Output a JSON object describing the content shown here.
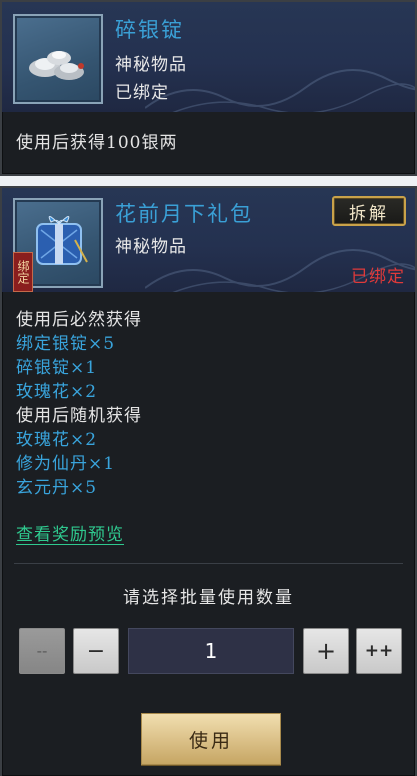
{
  "item1": {
    "name": "碎银锭",
    "type": "神秘物品",
    "bind_status": "已绑定",
    "description": "使用后获得100银两",
    "icon": "silver-ingot-icon"
  },
  "item2": {
    "name": "花前月下礼包",
    "type": "神秘物品",
    "bind_status": "已绑定",
    "bind_tag": "绑定",
    "decompose_label": "拆解",
    "icon": "gift-package-icon",
    "rewards": [
      {
        "text": "使用后必然获得",
        "color": "white"
      },
      {
        "text": "绑定银锭×5",
        "color": "blue"
      },
      {
        "text": "碎银锭×1",
        "color": "blue"
      },
      {
        "text": "玫瑰花×2",
        "color": "blue"
      },
      {
        "text": "使用后随机获得",
        "color": "white"
      },
      {
        "text": "玫瑰花×2",
        "color": "blue"
      },
      {
        "text": "修为仙丹×1",
        "color": "blue"
      },
      {
        "text": "玄元丹×5",
        "color": "blue"
      }
    ],
    "preview_link": "查看奖励预览"
  },
  "batch": {
    "label": "请选择批量使用数量",
    "min_label": "--",
    "minus_label": "−",
    "quantity": "1",
    "plus_label": "+",
    "max_label": "++",
    "use_label": "使用"
  },
  "colors": {
    "title_blue": "#3aa0d6",
    "bound_red": "#e03a3a",
    "link_green": "#2fc98f",
    "gold_border": "#c9a24a"
  }
}
